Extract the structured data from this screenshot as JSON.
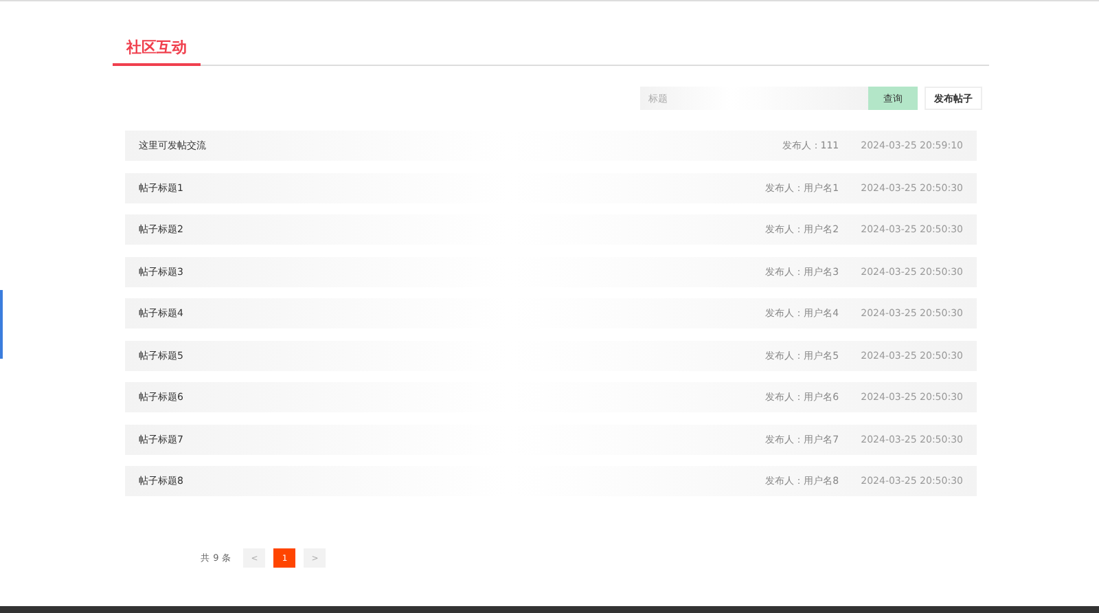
{
  "tabs": [
    {
      "label": "社区互动",
      "selected": true
    }
  ],
  "search": {
    "placeholder": "标题",
    "button": "查询"
  },
  "publish_button": "发布帖子",
  "posts": [
    {
      "title": "这里可发帖交流",
      "author": "发布人：111",
      "time": "2024-03-25 20:59:10"
    },
    {
      "title": "帖子标题1",
      "author": "发布人：用户名1",
      "time": "2024-03-25 20:50:30"
    },
    {
      "title": "帖子标题2",
      "author": "发布人：用户名2",
      "time": "2024-03-25 20:50:30"
    },
    {
      "title": "帖子标题3",
      "author": "发布人：用户名3",
      "time": "2024-03-25 20:50:30"
    },
    {
      "title": "帖子标题4",
      "author": "发布人：用户名4",
      "time": "2024-03-25 20:50:30"
    },
    {
      "title": "帖子标题5",
      "author": "发布人：用户名5",
      "time": "2024-03-25 20:50:30"
    },
    {
      "title": "帖子标题6",
      "author": "发布人：用户名6",
      "time": "2024-03-25 20:50:30"
    },
    {
      "title": "帖子标题7",
      "author": "发布人：用户名7",
      "time": "2024-03-25 20:50:30"
    },
    {
      "title": "帖子标题8",
      "author": "发布人：用户名8",
      "time": "2024-03-25 20:50:30"
    }
  ],
  "pagination": {
    "total": "共 9 条",
    "prev": "<",
    "next": ">",
    "pages": [
      {
        "label": "1",
        "selected": true
      }
    ]
  }
}
